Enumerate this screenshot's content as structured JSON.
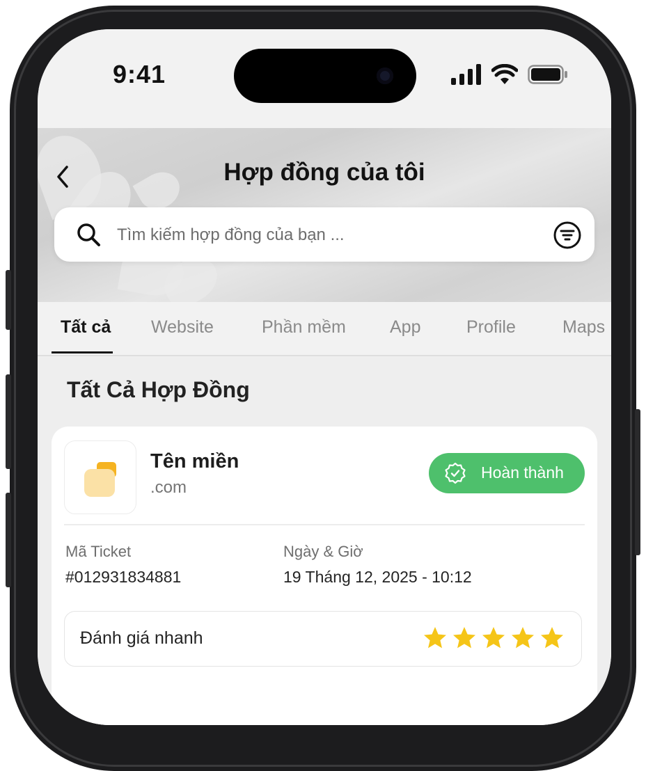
{
  "status_bar": {
    "time": "9:41",
    "icons": [
      "signal-icon",
      "wifi-icon",
      "battery-icon"
    ]
  },
  "header": {
    "title": "Hợp đồng của tôi",
    "back_icon": "chevron-left-icon"
  },
  "search": {
    "placeholder": "Tìm kiếm hợp đồng của bạn ...",
    "value": "",
    "search_icon": "search-icon",
    "filter_icon": "filter-icon"
  },
  "tabs": [
    {
      "label": "Tất cả",
      "active": true
    },
    {
      "label": "Website",
      "active": false
    },
    {
      "label": "Phần mềm",
      "active": false
    },
    {
      "label": "App",
      "active": false
    },
    {
      "label": "Profile",
      "active": false
    },
    {
      "label": "Maps",
      "active": false
    }
  ],
  "section": {
    "title": "Tất Cả Hợp Đồng"
  },
  "contract_card": {
    "name": "Tên miền",
    "extension": ".com",
    "status": {
      "label": "Hoàn thành",
      "color": "#4ec06c",
      "icon": "verified-badge-icon"
    },
    "ticket_label": "Mã Ticket",
    "ticket_value": "#012931834881",
    "date_label": "Ngày & Giờ",
    "date_value": "19 Tháng 12, 2025 - 10:12",
    "rating": {
      "label": "Đánh giá nhanh",
      "stars": 5,
      "max": 5,
      "star_color": "#f5c518"
    }
  }
}
